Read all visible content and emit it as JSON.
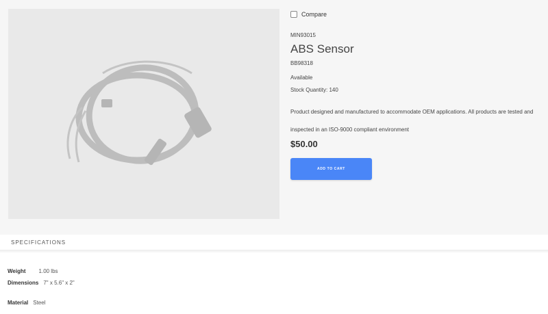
{
  "compare_label": "Compare",
  "product": {
    "sku": "MIN93015",
    "title": "ABS Sensor",
    "part_number": "BB98318",
    "availability": "Available",
    "stock": "Stock Quantity: 140",
    "description": "Product designed and manufactured to accommodate OEM applications. All products are tested and inspected in an ISO-9000 compliant environment",
    "price": "$50.00",
    "add_to_cart": "ADD TO CART",
    "image_icon": "cable-sensor-image"
  },
  "specifications": {
    "header": "SPECIFICATIONS",
    "rows": [
      {
        "key": "Weight",
        "value": "1.00 lbs"
      },
      {
        "key": "Dimensions",
        "value": "7\" x 5.6\" x 2\""
      },
      {
        "key": "Material",
        "value": "Steel"
      }
    ]
  },
  "colors": {
    "accent": "#4a86f7",
    "background": "#f6f6f6",
    "image_bg": "#e9e9e9"
  }
}
